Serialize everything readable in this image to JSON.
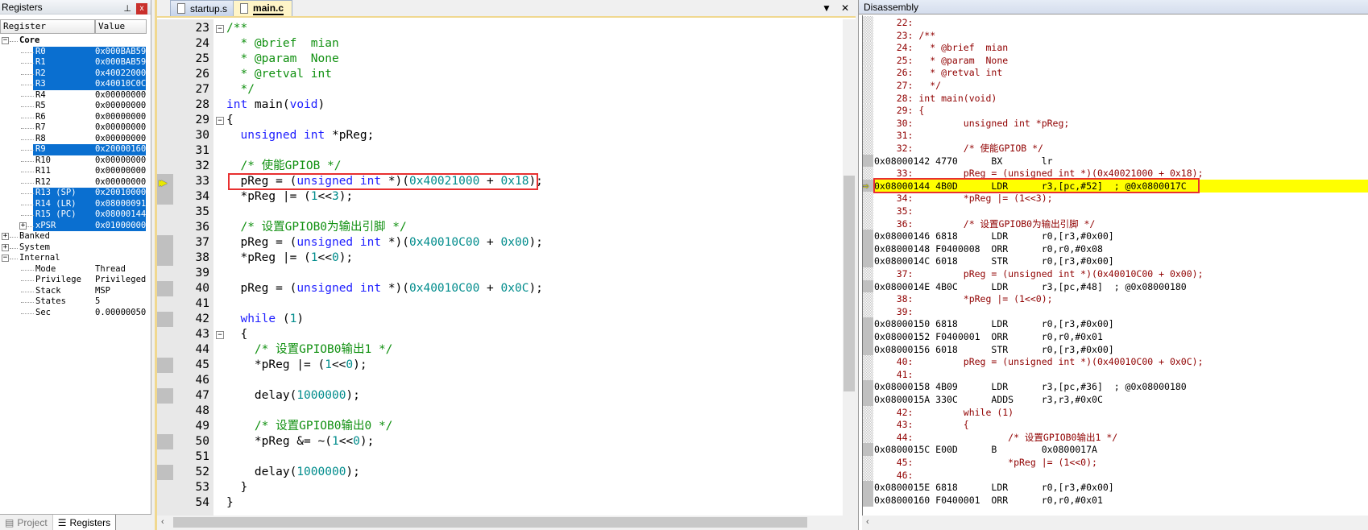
{
  "registers": {
    "title": "Registers",
    "pin": "⊥",
    "close": "x",
    "columns": [
      "Register",
      "Value"
    ],
    "rows": [
      {
        "name": "Core",
        "value": "",
        "level": 0,
        "exp": "−",
        "bold": true
      },
      {
        "name": "R0",
        "value": "0x000BAB59",
        "level": 1,
        "sel": true
      },
      {
        "name": "R1",
        "value": "0x000BAB59",
        "level": 1,
        "sel": true
      },
      {
        "name": "R2",
        "value": "0x40022000",
        "level": 1,
        "sel": true
      },
      {
        "name": "R3",
        "value": "0x40010C0C",
        "level": 1,
        "sel": true
      },
      {
        "name": "R4",
        "value": "0x00000000",
        "level": 1
      },
      {
        "name": "R5",
        "value": "0x00000000",
        "level": 1
      },
      {
        "name": "R6",
        "value": "0x00000000",
        "level": 1
      },
      {
        "name": "R7",
        "value": "0x00000000",
        "level": 1
      },
      {
        "name": "R8",
        "value": "0x00000000",
        "level": 1
      },
      {
        "name": "R9",
        "value": "0x20000160",
        "level": 1,
        "sel": true
      },
      {
        "name": "R10",
        "value": "0x00000000",
        "level": 1
      },
      {
        "name": "R11",
        "value": "0x00000000",
        "level": 1
      },
      {
        "name": "R12",
        "value": "0x00000000",
        "level": 1
      },
      {
        "name": "R13 (SP)",
        "value": "0x20010000",
        "level": 1,
        "sel": true
      },
      {
        "name": "R14 (LR)",
        "value": "0x08000091",
        "level": 1,
        "sel": true
      },
      {
        "name": "R15 (PC)",
        "value": "0x08000144",
        "level": 1,
        "sel": true
      },
      {
        "name": "xPSR",
        "value": "0x01000000",
        "level": 1,
        "sel": true,
        "exp": "+"
      },
      {
        "name": "Banked",
        "value": "",
        "level": 0,
        "exp": "+"
      },
      {
        "name": "System",
        "value": "",
        "level": 0,
        "exp": "+"
      },
      {
        "name": "Internal",
        "value": "",
        "level": 0,
        "exp": "−"
      },
      {
        "name": "Mode",
        "value": "Thread",
        "level": 1
      },
      {
        "name": "Privilege",
        "value": "Privileged",
        "level": 1
      },
      {
        "name": "Stack",
        "value": "MSP",
        "level": 1
      },
      {
        "name": "States",
        "value": "5",
        "level": 1
      },
      {
        "name": "Sec",
        "value": "0.00000050",
        "level": 1
      }
    ],
    "bottom_tabs": [
      {
        "label": "Project",
        "active": false
      },
      {
        "label": "Registers",
        "active": true
      }
    ]
  },
  "editor": {
    "tabs": [
      {
        "label": "startup.s",
        "active": false
      },
      {
        "label": "main.c",
        "active": true
      }
    ],
    "dropdown": "▼",
    "close": "✕",
    "current_line": 33,
    "lines": [
      {
        "n": "23",
        "fold": "−",
        "seg": [
          [
            "/**",
            "cm"
          ]
        ]
      },
      {
        "n": "24",
        "seg": [
          [
            "  * @brief  mian",
            "cm"
          ]
        ]
      },
      {
        "n": "25",
        "seg": [
          [
            "  * @param  None",
            "cm"
          ]
        ]
      },
      {
        "n": "26",
        "seg": [
          [
            "  * @retval int",
            "cm"
          ]
        ]
      },
      {
        "n": "27",
        "seg": [
          [
            "  */",
            "cm"
          ]
        ]
      },
      {
        "n": "28",
        "seg": [
          [
            "int",
            "kw"
          ],
          [
            " main(",
            "pl"
          ],
          [
            "void",
            "kw"
          ],
          [
            ")",
            "pl"
          ]
        ]
      },
      {
        "n": "29",
        "fold": "−",
        "seg": [
          [
            "{",
            "pl"
          ]
        ]
      },
      {
        "n": "30",
        "seg": [
          [
            "  ",
            "pl"
          ],
          [
            "unsigned",
            "kw"
          ],
          [
            " ",
            "pl"
          ],
          [
            "int",
            "kw"
          ],
          [
            " *pReg;",
            "pl"
          ]
        ]
      },
      {
        "n": "31",
        "seg": []
      },
      {
        "n": "32",
        "seg": [
          [
            "  /* 使能GPIOB */",
            "cm"
          ]
        ]
      },
      {
        "n": "33",
        "mk": true,
        "cur": true,
        "seg": [
          [
            "  pReg = (",
            "pl"
          ],
          [
            "unsigned",
            "kw"
          ],
          [
            " ",
            "pl"
          ],
          [
            "int",
            "kw"
          ],
          [
            " *)(",
            "pl"
          ],
          [
            "0x40021000",
            "nm"
          ],
          [
            " + ",
            "pl"
          ],
          [
            "0x18",
            "nm"
          ],
          [
            ");",
            "pl"
          ]
        ]
      },
      {
        "n": "34",
        "mk": true,
        "seg": [
          [
            "  *pReg |= (",
            "pl"
          ],
          [
            "1",
            "nm"
          ],
          [
            "<<",
            "pl"
          ],
          [
            "3",
            "nm"
          ],
          [
            ");",
            "pl"
          ]
        ]
      },
      {
        "n": "35",
        "seg": []
      },
      {
        "n": "36",
        "seg": [
          [
            "  /* 设置GPIOB0为输出引脚 */",
            "cm"
          ]
        ]
      },
      {
        "n": "37",
        "mk": true,
        "seg": [
          [
            "  pReg = (",
            "pl"
          ],
          [
            "unsigned",
            "kw"
          ],
          [
            " ",
            "pl"
          ],
          [
            "int",
            "kw"
          ],
          [
            " *)(",
            "pl"
          ],
          [
            "0x40010C00",
            "nm"
          ],
          [
            " + ",
            "pl"
          ],
          [
            "0x00",
            "nm"
          ],
          [
            ");",
            "pl"
          ]
        ]
      },
      {
        "n": "38",
        "mk": true,
        "seg": [
          [
            "  *pReg |= (",
            "pl"
          ],
          [
            "1",
            "nm"
          ],
          [
            "<<",
            "pl"
          ],
          [
            "0",
            "nm"
          ],
          [
            ");",
            "pl"
          ]
        ]
      },
      {
        "n": "39",
        "seg": []
      },
      {
        "n": "40",
        "mk": true,
        "seg": [
          [
            "  pReg = (",
            "pl"
          ],
          [
            "unsigned",
            "kw"
          ],
          [
            " ",
            "pl"
          ],
          [
            "int",
            "kw"
          ],
          [
            " *)(",
            "pl"
          ],
          [
            "0x40010C00",
            "nm"
          ],
          [
            " + ",
            "pl"
          ],
          [
            "0x0C",
            "nm"
          ],
          [
            ");",
            "pl"
          ]
        ]
      },
      {
        "n": "41",
        "seg": []
      },
      {
        "n": "42",
        "mk": true,
        "seg": [
          [
            "  ",
            "pl"
          ],
          [
            "while",
            "kw"
          ],
          [
            " (",
            "pl"
          ],
          [
            "1",
            "nm"
          ],
          [
            ")",
            "pl"
          ]
        ]
      },
      {
        "n": "43",
        "fold": "−",
        "seg": [
          [
            "  {",
            "pl"
          ]
        ]
      },
      {
        "n": "44",
        "seg": [
          [
            "    /* 设置GPIOB0输出1 */",
            "cm"
          ]
        ]
      },
      {
        "n": "45",
        "mk": true,
        "seg": [
          [
            "    *pReg |= (",
            "pl"
          ],
          [
            "1",
            "nm"
          ],
          [
            "<<",
            "pl"
          ],
          [
            "0",
            "nm"
          ],
          [
            ");",
            "pl"
          ]
        ]
      },
      {
        "n": "46",
        "seg": []
      },
      {
        "n": "47",
        "mk": true,
        "seg": [
          [
            "    delay(",
            "pl"
          ],
          [
            "1000000",
            "nm"
          ],
          [
            ");",
            "pl"
          ]
        ]
      },
      {
        "n": "48",
        "seg": []
      },
      {
        "n": "49",
        "seg": [
          [
            "    /* 设置GPIOB0输出0 */",
            "cm"
          ]
        ]
      },
      {
        "n": "50",
        "mk": true,
        "seg": [
          [
            "    *pReg &= ~(",
            "pl"
          ],
          [
            "1",
            "nm"
          ],
          [
            "<<",
            "pl"
          ],
          [
            "0",
            "nm"
          ],
          [
            ");",
            "pl"
          ]
        ]
      },
      {
        "n": "51",
        "seg": []
      },
      {
        "n": "52",
        "mk": true,
        "seg": [
          [
            "    delay(",
            "pl"
          ],
          [
            "1000000",
            "nm"
          ],
          [
            ");",
            "pl"
          ]
        ]
      },
      {
        "n": "53",
        "seg": [
          [
            "  }",
            "pl"
          ]
        ]
      },
      {
        "n": "54",
        "seg": [
          [
            "}",
            "pl"
          ]
        ]
      }
    ]
  },
  "disassembly": {
    "title": "Disassembly",
    "rows": [
      {
        "k": "src",
        "t": "    22: "
      },
      {
        "k": "src",
        "t": "    23: /**"
      },
      {
        "k": "src",
        "t": "    24:   * @brief  mian"
      },
      {
        "k": "src",
        "t": "    25:   * @param  None"
      },
      {
        "k": "src",
        "t": "    26:   * @retval int"
      },
      {
        "k": "src",
        "t": "    27:   */"
      },
      {
        "k": "src",
        "t": "    28: int main(void)"
      },
      {
        "k": "src",
        "t": "    29: {"
      },
      {
        "k": "src",
        "t": "    30:         unsigned int *pReg;"
      },
      {
        "k": "src",
        "t": "    31: "
      },
      {
        "k": "src",
        "t": "    32:         /* 使能GPIOB */"
      },
      {
        "k": "asm",
        "t": "0x08000142 4770      BX       lr"
      },
      {
        "k": "src",
        "t": "    33:         pReg = (unsigned int *)(0x40021000 + 0x18);"
      },
      {
        "k": "asm",
        "cur": true,
        "t": "0x08000144 4B0D      LDR      r3,[pc,#52]  ; @0x0800017C"
      },
      {
        "k": "src",
        "t": "    34:         *pReg |= (1<<3);"
      },
      {
        "k": "src",
        "t": "    35: "
      },
      {
        "k": "src",
        "t": "    36:         /* 设置GPIOB0为输出引脚 */"
      },
      {
        "k": "asm",
        "t": "0x08000146 6818      LDR      r0,[r3,#0x00]"
      },
      {
        "k": "asm",
        "t": "0x08000148 F0400008  ORR      r0,r0,#0x08"
      },
      {
        "k": "asm",
        "t": "0x0800014C 6018      STR      r0,[r3,#0x00]"
      },
      {
        "k": "src",
        "t": "    37:         pReg = (unsigned int *)(0x40010C00 + 0x00);"
      },
      {
        "k": "asm",
        "t": "0x0800014E 4B0C      LDR      r3,[pc,#48]  ; @0x08000180"
      },
      {
        "k": "src",
        "t": "    38:         *pReg |= (1<<0);"
      },
      {
        "k": "src",
        "t": "    39: "
      },
      {
        "k": "asm",
        "t": "0x08000150 6818      LDR      r0,[r3,#0x00]"
      },
      {
        "k": "asm",
        "t": "0x08000152 F0400001  ORR      r0,r0,#0x01"
      },
      {
        "k": "asm",
        "t": "0x08000156 6018      STR      r0,[r3,#0x00]"
      },
      {
        "k": "src",
        "t": "    40:         pReg = (unsigned int *)(0x40010C00 + 0x0C);"
      },
      {
        "k": "src",
        "t": "    41: "
      },
      {
        "k": "asm",
        "t": "0x08000158 4B09      LDR      r3,[pc,#36]  ; @0x08000180"
      },
      {
        "k": "asm",
        "t": "0x0800015A 330C      ADDS     r3,r3,#0x0C"
      },
      {
        "k": "src",
        "t": "    42:         while (1)"
      },
      {
        "k": "src",
        "t": "    43:         {"
      },
      {
        "k": "src",
        "t": "    44:                 /* 设置GPIOB0输出1 */"
      },
      {
        "k": "asm",
        "t": "0x0800015C E00D      B        0x0800017A"
      },
      {
        "k": "src",
        "t": "    45:                 *pReg |= (1<<0);"
      },
      {
        "k": "src",
        "t": "    46: "
      },
      {
        "k": "asm",
        "t": "0x0800015E 6818      LDR      r0,[r3,#0x00]"
      },
      {
        "k": "asm",
        "t": "0x08000160 F0400001  ORR      r0,r0,#0x01"
      }
    ]
  },
  "colors": {
    "selection": "#0a6fd0",
    "keyword": "#2020ff",
    "comment": "#109010",
    "number": "#008c8c",
    "current_line": "#ffff00",
    "highlight_box": "#e83030",
    "source_text": "#900000"
  }
}
